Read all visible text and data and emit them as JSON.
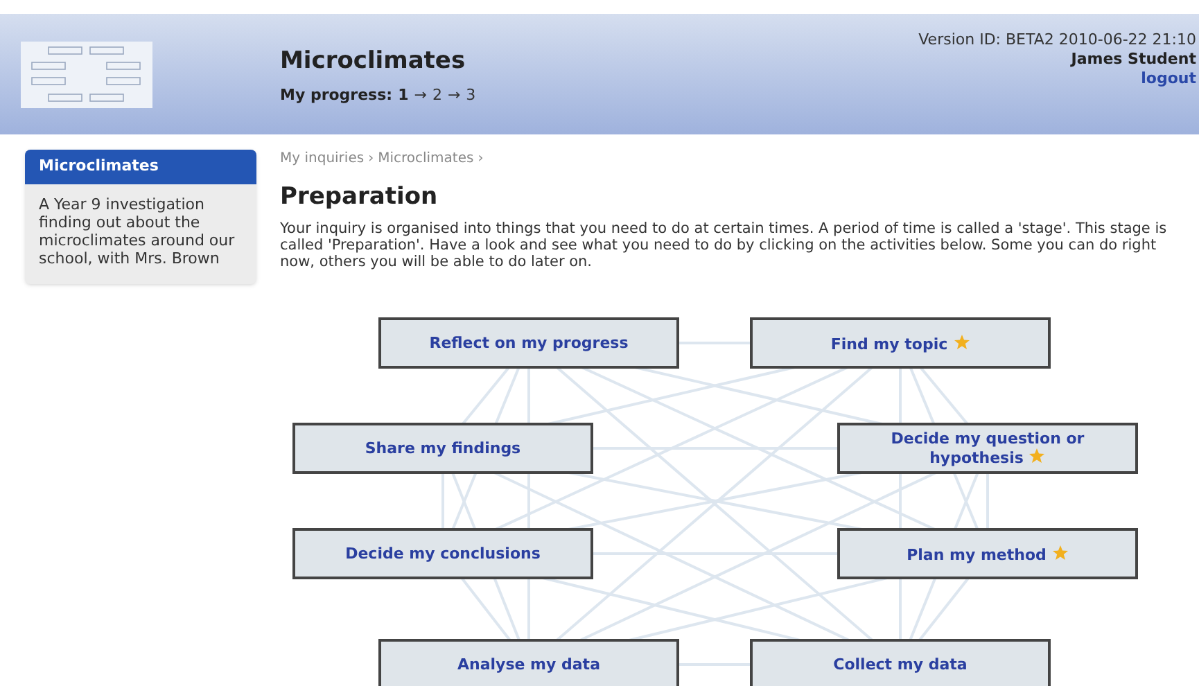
{
  "header": {
    "title": "Microclimates",
    "progress_label": "My progress:",
    "progress_steps": [
      {
        "label": "1",
        "selected": true
      },
      {
        "label": "2",
        "selected": false
      },
      {
        "label": "3",
        "selected": false
      }
    ],
    "arrow": "→",
    "version": "Version ID: BETA2 2010-06-22 21:10",
    "user": "James Student",
    "logout": "logout"
  },
  "sidebar": {
    "title": "Microclimates",
    "description": "A Year 9 investigation finding out about the microclimates around our school, with Mrs. Brown"
  },
  "breadcrumb": [
    {
      "label": "My inquiries"
    },
    {
      "label": "Microclimates"
    }
  ],
  "breadcrumb_separator": "›",
  "page_title": "Preparation",
  "intro": "Your inquiry is organised into things that you need to do at certain times. A period of time is called a 'stage'. This stage is called 'Preparation'. Have a look and see what you need to do by clicking on the activities below. Some you can do right now, others you will be able to do later on.",
  "activities": [
    {
      "label": "Reflect on my progress",
      "starred": false
    },
    {
      "label": "Find my topic",
      "starred": true
    },
    {
      "label": "Share my findings",
      "starred": false
    },
    {
      "label": "Decide my question or hypothesis",
      "starred": true
    },
    {
      "label": "Decide my conclusions",
      "starred": false
    },
    {
      "label": "Plan my method",
      "starred": true
    },
    {
      "label": "Analyse my data",
      "starred": false
    },
    {
      "label": "Collect my data",
      "starred": false
    }
  ]
}
